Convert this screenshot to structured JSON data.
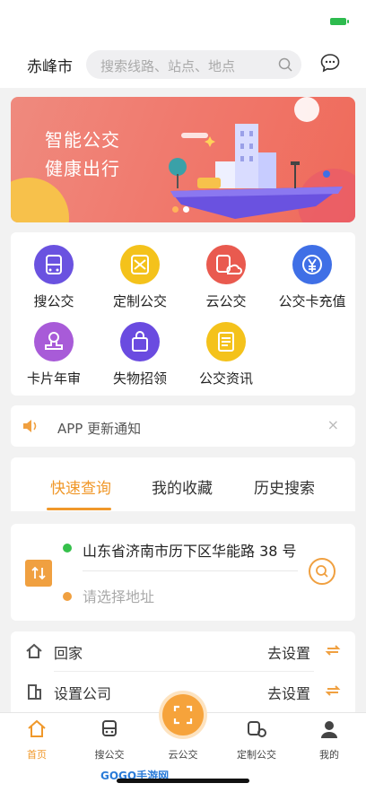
{
  "header": {
    "city": "赤峰市",
    "search_placeholder": "搜索线路、站点、地点"
  },
  "banner": {
    "line1": "智能公交",
    "line2": "健康出行"
  },
  "grid": [
    {
      "label": "搜公交",
      "icon": "bus-icon",
      "color": "#6a52e0"
    },
    {
      "label": "定制公交",
      "icon": "custom-bus-icon",
      "color": "#f4c21b"
    },
    {
      "label": "云公交",
      "icon": "cloud-bus-icon",
      "color": "#e95a4f"
    },
    {
      "label": "公交卡充值",
      "icon": "yen-icon",
      "color": "#3f6fe6"
    },
    {
      "label": "卡片年审",
      "icon": "stamp-icon",
      "color": "#a85bd8"
    },
    {
      "label": "失物招领",
      "icon": "bag-icon",
      "color": "#6a4be0"
    },
    {
      "label": "公交资讯",
      "icon": "news-icon",
      "color": "#f4c21b"
    }
  ],
  "notice": {
    "text": "APP 更新通知",
    "close": "×"
  },
  "tabs": {
    "items": [
      "快速查询",
      "我的收藏",
      "历史搜索"
    ],
    "active": 0
  },
  "route": {
    "from": "山东省济南市历下区华能路 38 号",
    "to_placeholder": "请选择地址"
  },
  "shortcuts": [
    {
      "label": "回家",
      "action": "去设置",
      "icon": "home-icon"
    },
    {
      "label": "设置公司",
      "action": "去设置",
      "icon": "building-icon"
    }
  ],
  "tabbar": {
    "items": [
      {
        "label": "首页",
        "icon": "home-icon"
      },
      {
        "label": "搜公交",
        "icon": "bus-icon"
      },
      {
        "label": "云公交",
        "icon": "scan-icon"
      },
      {
        "label": "定制公交",
        "icon": "custom-bus-icon"
      },
      {
        "label": "我的",
        "icon": "user-icon"
      }
    ],
    "active": 0
  },
  "watermark": "GOGO手游网",
  "colors": {
    "accent": "#f0982a",
    "green": "#35c04b"
  }
}
